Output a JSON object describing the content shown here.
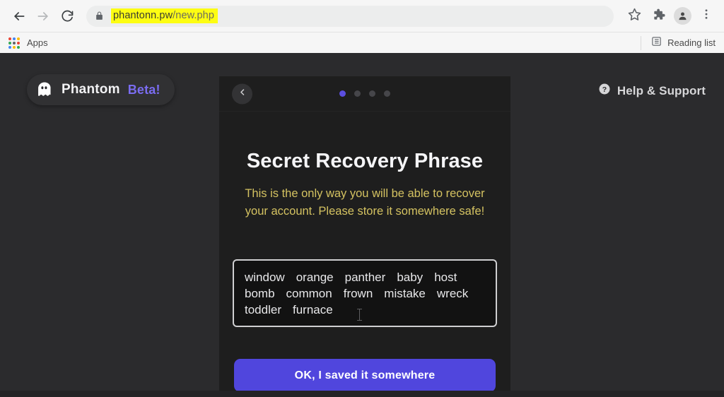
{
  "browser": {
    "back_icon": "arrow-left-icon",
    "forward_icon": "arrow-right-icon",
    "reload_icon": "reload-icon",
    "lock_icon": "lock-icon",
    "url_domain": "phantonn.pw",
    "url_path": "/new.php",
    "url_highlight_color": "#fdfd12",
    "bookmark_icon": "star-icon",
    "extensions_icon": "puzzle-icon",
    "profile_icon": "profile-avatar-icon",
    "menu_icon": "three-dot-menu-icon",
    "apps_label": "Apps",
    "reading_list_label": "Reading list",
    "reading_list_icon": "reading-list-icon"
  },
  "page": {
    "background_color": "#2b2b2d",
    "brand": {
      "logo_icon": "phantom-ghost-icon",
      "name": "Phantom",
      "beta": "Beta!",
      "beta_color": "#7a6cf0"
    },
    "help": {
      "icon": "help-circle-icon",
      "label": "Help & Support"
    }
  },
  "modal": {
    "background_color": "#1e1e1e",
    "back_icon": "chevron-left-icon",
    "pagination": {
      "total": 4,
      "active_index": 0,
      "active_color": "#5b4ee0",
      "inactive_color": "#46464a"
    },
    "title": "Secret Recovery Phrase",
    "warning": "This is the only way you will be able to recover your account. Please store it somewhere safe!",
    "warning_color": "#d4c261",
    "seed_phrase": {
      "words": [
        "window",
        "orange",
        "panther",
        "baby",
        "host",
        "bomb",
        "common",
        "frown",
        "mistake",
        "wreck",
        "toddler",
        "furnace"
      ],
      "word_count": 12,
      "border_color": "#cfcfd1"
    },
    "primary_button": {
      "label": "OK, I saved it somewhere",
      "color": "#5046dd"
    }
  }
}
